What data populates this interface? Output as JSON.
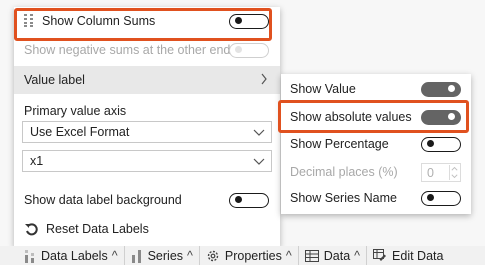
{
  "menu": {
    "show_column_sums": "Show Column Sums",
    "show_negative_sums": "Show negative sums at the other end",
    "value_label": "Value label",
    "value_label_arrow": ">",
    "primary_value_axis": "Primary value axis",
    "format_select": "Use Excel Format",
    "scale_select": "x1",
    "show_label_background": "Show data label background",
    "reset_labels": "Reset Data Labels"
  },
  "submenu": {
    "show_value": "Show Value",
    "show_absolute_values": "Show absolute values",
    "show_percentage": "Show Percentage",
    "decimal_places": "Decimal places (%)",
    "decimal_value": "0",
    "show_series_name": "Show Series Name"
  },
  "toolbar": {
    "data_labels": "Data Labels",
    "series": "Series",
    "properties": "Properties",
    "data": "Data",
    "edit_data": "Edit Data",
    "caret": "^"
  },
  "colors": {
    "highlight": "#e0511f",
    "toggle_on": "#646464",
    "hover_row": "#e8e8e8"
  },
  "icons": [
    "column-sums-icon",
    "chevron-right-icon",
    "chevron-down-icon",
    "reset-icon",
    "data-labels-icon",
    "series-icon",
    "gear-icon",
    "table-icon",
    "edit-table-icon"
  ]
}
